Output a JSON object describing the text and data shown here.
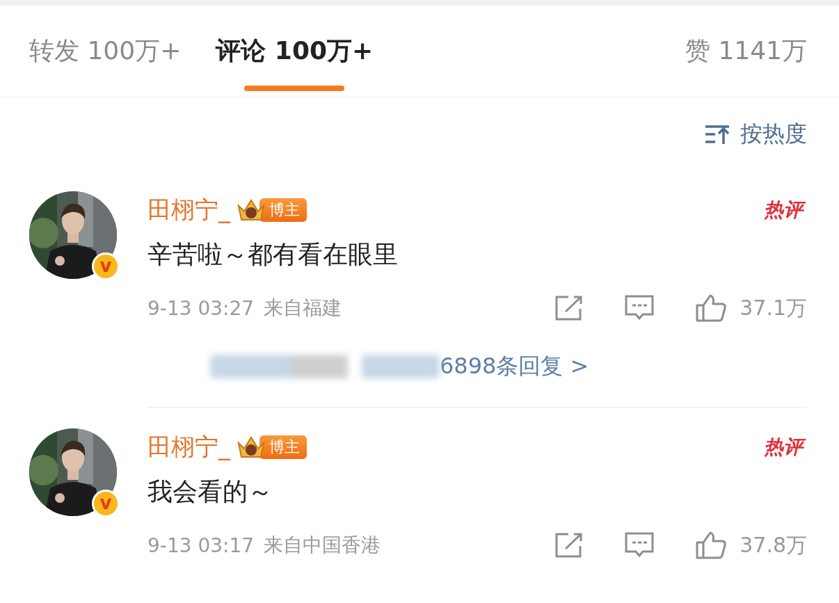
{
  "tabs": [
    {
      "label": "转发",
      "count": "100万+",
      "selected": false
    },
    {
      "label": "评论",
      "count": "100万+",
      "selected": true
    },
    {
      "label": "赞",
      "count": "1141万",
      "selected": false
    }
  ],
  "sort": {
    "label": "按热度"
  },
  "comments": [
    {
      "name": "田栩宁_",
      "badge": "博主",
      "verified_mark": "v",
      "hot": "热评",
      "text": "辛苦啦～都有看在眼里",
      "time": "9-13 03:27",
      "source": "来自福建",
      "likes": "37.1万",
      "replies": "6898条回复 >"
    },
    {
      "name": "田栩宁_",
      "badge": "博主",
      "verified_mark": "v",
      "hot": "热评",
      "text": "我会看的～",
      "time": "9-13 03:17",
      "source": "来自中国香港",
      "likes": "37.8万"
    }
  ]
}
